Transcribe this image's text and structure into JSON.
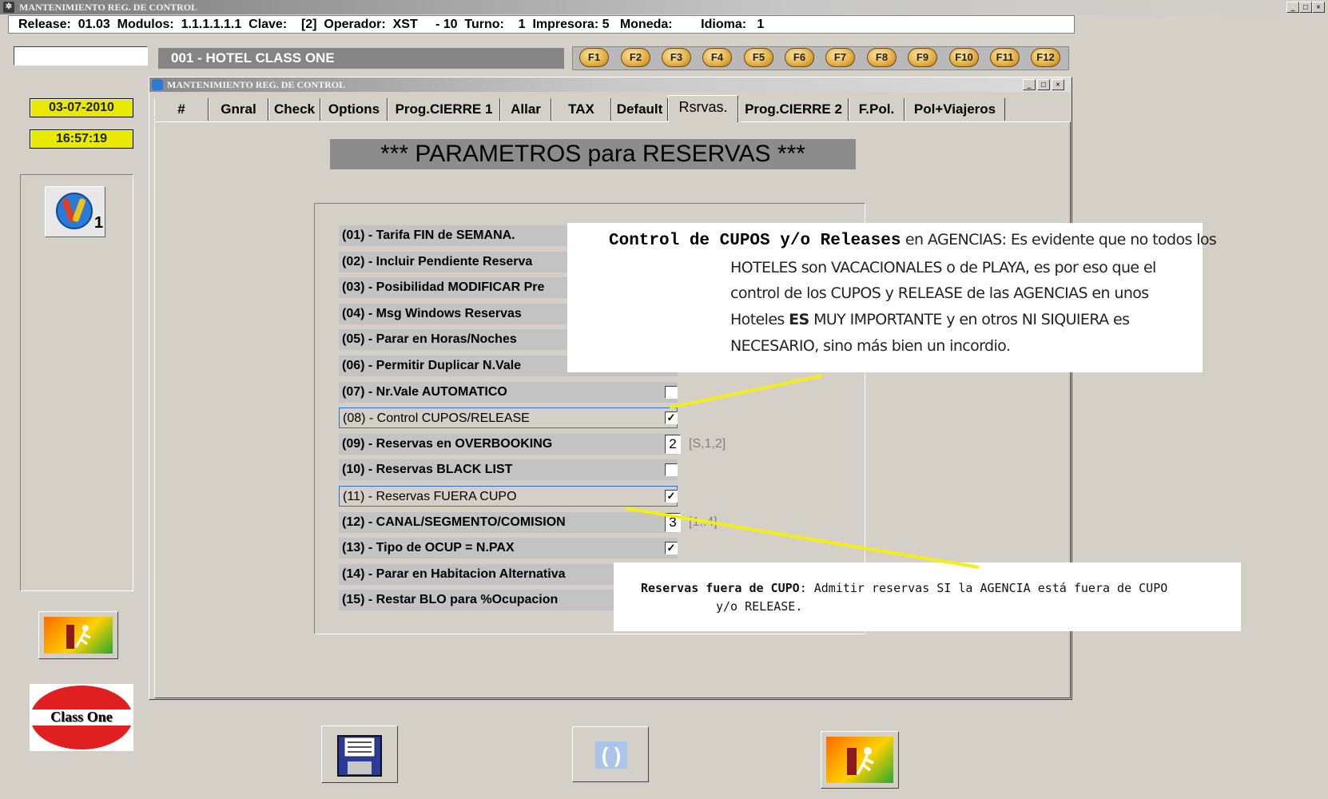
{
  "window": {
    "title": "MANTENIMIENTO REG. DE CONTROL",
    "controls": [
      "_",
      "□",
      "×"
    ]
  },
  "infobar": {
    "text": "Release:  01.03  Modulos:  1.1.1.1.1.1  Clave:    [2]  Operador:  XST     - 10  Turno:    1  Impresora: 5   Moneda:        Idioma:   1"
  },
  "command_input": {
    "value": ""
  },
  "hotel": {
    "label": "001 - HOTEL CLASS ONE"
  },
  "fkeys": [
    "F1",
    "F2",
    "F3",
    "F4",
    "F5",
    "F6",
    "F7",
    "F8",
    "F9",
    "F10",
    "F11",
    "F12"
  ],
  "left": {
    "date": "03-07-2010",
    "time": "16:57:19",
    "tool_badge": "1",
    "logo_text": "Class One"
  },
  "inner_window": {
    "title": "MANTENIMIENTO REG. DE CONTROL",
    "controls": [
      "_",
      "□",
      "×"
    ]
  },
  "tabs": [
    "#",
    "Gnral",
    "Check",
    "Options",
    "Prog.CIERRE 1",
    "Allar",
    "TAX",
    "Default",
    "Rsrvas.",
    "Prog.CIERRE 2",
    "F.Pol.",
    "Pol+Viajeros"
  ],
  "active_tab": "Rsrvas.",
  "banner": "*** PARAMETROS para RESERVAS ***",
  "params": [
    {
      "label": "(01) - Tarifa FIN de SEMANA."
    },
    {
      "label": "(02) - Incluir Pendiente Reserva"
    },
    {
      "label": "(03) - Posibilidad MODIFICAR Pre"
    },
    {
      "label": "(04) - Msg Windows Reservas"
    },
    {
      "label": "(05) - Parar en Horas/Noches"
    },
    {
      "label": "(06) - Permitir Duplicar N.Vale"
    },
    {
      "label": "(07) - Nr.Vale AUTOMATICO",
      "checkbox": ""
    },
    {
      "label": "(08) - Control CUPOS/RELEASE",
      "checkbox": "✓"
    },
    {
      "label": "(09) - Reservas en OVERBOOKING",
      "value": "2",
      "hint": "[S,1,2]"
    },
    {
      "label": "(10) - Reservas BLACK LIST",
      "checkbox": ""
    },
    {
      "label": "(11) - Reservas FUERA CUPO",
      "checkbox": "✓"
    },
    {
      "label": "(12) - CANAL/SEGMENTO/COMISION",
      "value": "3",
      "hint": "[1..4]"
    },
    {
      "label": "(13) - Tipo de OCUP = N.PAX",
      "checkbox": "✓"
    },
    {
      "label": "(14) - Parar en Habitacion Alternativa"
    },
    {
      "label": "(15) - Restar BLO para %Ocupacion"
    }
  ],
  "callout1": {
    "title": "Control de CUPOS y/o Releases",
    "line1_rest": " en  AGENCIAS:  Es evidente que no todos los",
    "line2": "HOTELES   son VACACIONALES o de PLAYA, es por eso que el",
    "line3": "control de los CUPOS   y   RELEASE de las AGENCIAS en unos",
    "line4a": "Hoteles ",
    "line4b": "ES",
    "line4c": "   MUY  IMPORTANTE  y en  otros  NI  SIQUIERA  es",
    "line5": "NECESARIO,  sino más bien un incordio."
  },
  "callout2": {
    "title": "Reservas fuera de CUPO",
    "line1_rest": ": Admitir reservas SI la AGENCIA está fuera de CUPO",
    "line2": "y/o RELEASE."
  },
  "buttons": {
    "save": "save-icon",
    "refresh": "refresh-icon",
    "exit": "exit-icon"
  }
}
